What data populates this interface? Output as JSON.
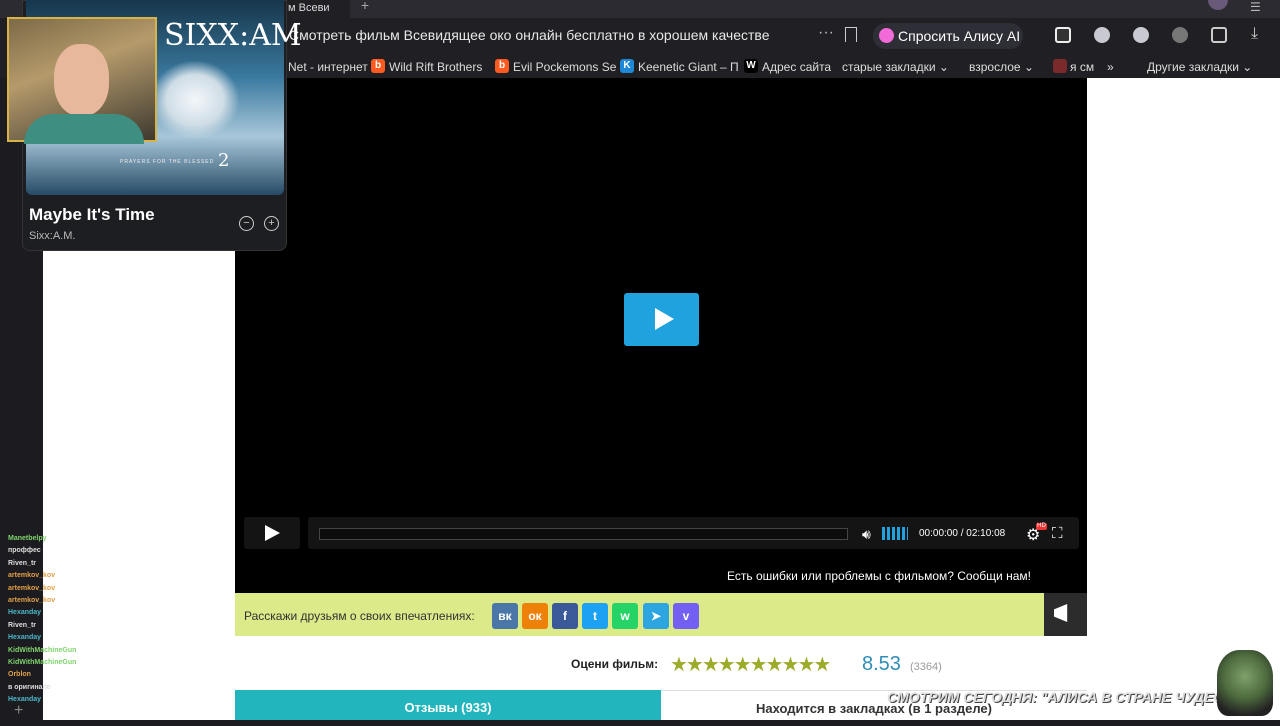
{
  "browser": {
    "tab_title": "м Всеви",
    "address_title": "Смотреть фильм Всевидящее око онлайн бесплатно в хорошем качестве",
    "more": "···",
    "alice_button": "Спросить Алису AI",
    "bookmarks": [
      {
        "label": "Net - интернет",
        "icon": ""
      },
      {
        "label": "Wild Rift Brothers",
        "icon": "b"
      },
      {
        "label": "Evil Pockemons Se",
        "icon": "b"
      },
      {
        "label": "Keenetic Giant – П",
        "icon": "K"
      },
      {
        "label": "Адрес сайта",
        "icon": "W"
      },
      {
        "label": "старые закладки ⌄",
        "icon": ""
      },
      {
        "label": "взрослое ⌄",
        "icon": ""
      },
      {
        "label": "я см",
        "icon": ""
      },
      {
        "label": "»",
        "icon": ""
      },
      {
        "label": "Другие закладки ⌄",
        "icon": ""
      }
    ]
  },
  "music": {
    "album_title": "SIXX:AM",
    "album_subtitle": "PRAYERS FOR THE BLESSED",
    "album_vol": "2",
    "song_title": "Maybe It's Time",
    "artist": "Sixx:A.M."
  },
  "player": {
    "time": "00:00:00 / 02:10:08",
    "report_text": "Есть ошибки или проблемы с фильмом? Сообщи нам!",
    "hd_badge": "HD"
  },
  "share": {
    "label": "Расскажи друзьям о своих впечатлениях:",
    "networks": [
      {
        "name": "vk",
        "glyph": "вк",
        "color": "#4a76a8"
      },
      {
        "name": "ok",
        "glyph": "ок",
        "color": "#ee8208"
      },
      {
        "name": "facebook",
        "glyph": "f",
        "color": "#3b5998"
      },
      {
        "name": "twitter",
        "glyph": "t",
        "color": "#1da1f2"
      },
      {
        "name": "whatsapp",
        "glyph": "w",
        "color": "#25d366"
      },
      {
        "name": "telegram",
        "glyph": "➤",
        "color": "#2ca5e0"
      },
      {
        "name": "viber",
        "glyph": "v",
        "color": "#7360f2"
      }
    ]
  },
  "rating": {
    "label": "Оцени фильм:",
    "stars": "★★★★★★★★★★",
    "score": "8.53",
    "votes": "(3364)"
  },
  "tabs": {
    "reviews": "Отзывы (933)",
    "bookmarks": "Находится в закладках (в 1 разделе)"
  },
  "chat": [
    {
      "user": "Manetbelpy",
      "color": "#7ed36b",
      "msg": ""
    },
    {
      "user": "проффес",
      "color": "#ddd",
      "msg": ""
    },
    {
      "user": "Riven_tr",
      "color": "#ddd",
      "msg": ""
    },
    {
      "user": "artemkov_kov",
      "color": "#e2a047",
      "msg": ""
    },
    {
      "user": "artemkov_kov",
      "color": "#e2a047",
      "msg": ""
    },
    {
      "user": "artemkov_kov",
      "color": "#e2a047",
      "msg": ""
    },
    {
      "user": "Hexanday",
      "color": "#4bb6c8",
      "msg": ""
    },
    {
      "user": "Riven_tr",
      "color": "#ddd",
      "msg": ""
    },
    {
      "user": "Hexanday",
      "color": "#4bb6c8",
      "msg": ""
    },
    {
      "user": "KidWithMachineGun",
      "color": "#7ed36b",
      "msg": ""
    },
    {
      "user": "KidWithMachineGun",
      "color": "#7ed36b",
      "msg": ""
    },
    {
      "user": "Orblon",
      "color": "#e2a047",
      "msg": ""
    },
    {
      "user": "в оригинале",
      "color": "#ddd",
      "msg": ""
    },
    {
      "user": "Hexanday",
      "color": "#4bb6c8",
      "msg": ""
    }
  ],
  "overlay": {
    "banner": "СМОТРИМ СЕГОДНЯ: \"АЛИСА В СТРАНЕ ЧУДЕС\""
  }
}
